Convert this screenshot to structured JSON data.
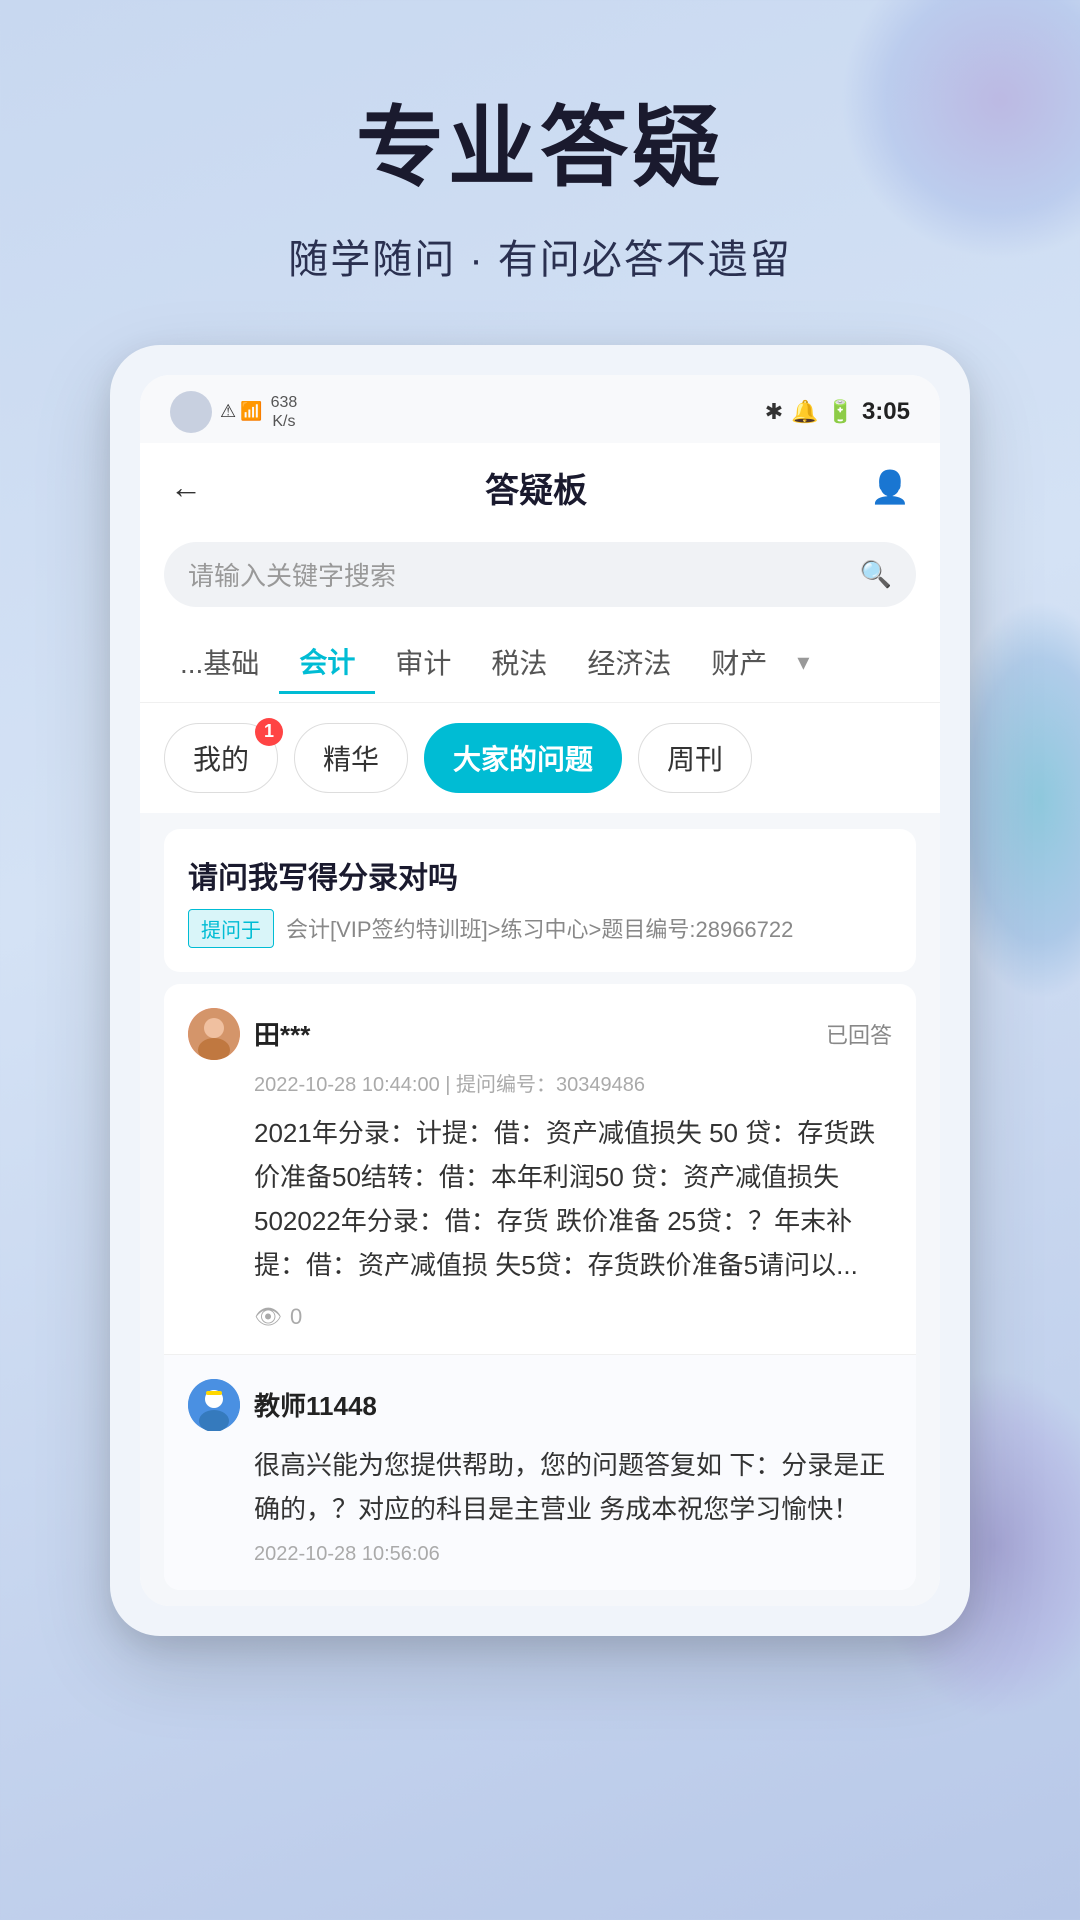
{
  "background": {
    "gradient_start": "#c8d8f0",
    "gradient_end": "#b8c8e8"
  },
  "hero": {
    "title": "专业答疑",
    "subtitle": "随学随问 · 有问必答不遗留"
  },
  "status_bar": {
    "speed": "638\nK/s",
    "speed_line1": "638",
    "speed_line2": "K/s",
    "time": "3:05",
    "battery_icon": "🔋",
    "bluetooth_icon": "⚡",
    "signal_icon": "📶"
  },
  "nav": {
    "title": "答疑板",
    "back_icon": "←",
    "profile_icon": "👤"
  },
  "search": {
    "placeholder": "请输入关键字搜索"
  },
  "categories": [
    {
      "label": "...基础",
      "active": false,
      "partial": true
    },
    {
      "label": "会计",
      "active": true
    },
    {
      "label": "审计",
      "active": false
    },
    {
      "label": "税法",
      "active": false
    },
    {
      "label": "经济法",
      "active": false
    },
    {
      "label": "财产",
      "active": false,
      "partial": true
    }
  ],
  "filter_tabs": [
    {
      "label": "我的",
      "active": false,
      "badge": "1"
    },
    {
      "label": "精华",
      "active": false
    },
    {
      "label": "大家的问题",
      "active": true
    },
    {
      "label": "周刊",
      "active": false
    }
  ],
  "question": {
    "title": "请问我写得分录对吗",
    "tag": "提问于",
    "meta": "会计[VIP签约特训班]>练习中心>题目编号:28966722"
  },
  "user_post": {
    "name": "田***",
    "answered_label": "已回答",
    "timestamp": "2022-10-28 10:44:00 | 提问编号：30349486",
    "content": "2021年分录：计提：借：资产减值损失 50\n贷：存货跌价准备50结转：借：本年利润50\n贷：资产减值损失502022年分录：借：存货\n跌价准备 25贷：？年末补提：借：资产减值损\n失5贷：存货跌价准备5请问以...",
    "view_count": "0",
    "view_icon": "👁"
  },
  "teacher_reply": {
    "name": "教师11448",
    "avatar_emoji": "🎓",
    "content": "很高兴能为您提供帮助，您的问题答复如\n下：分录是正确的，？对应的科目是主营业\n务成本祝您学习愉快！",
    "timestamp": "2022-10-28 10:56:06"
  }
}
